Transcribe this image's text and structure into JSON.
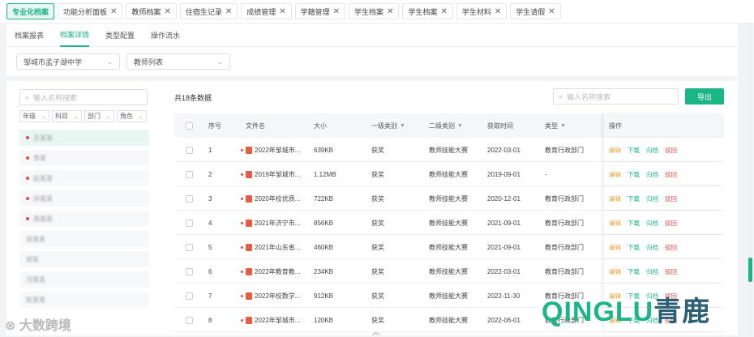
{
  "tabs": [
    {
      "label": "专业化档案",
      "active": true,
      "closable": false
    },
    {
      "label": "功能分析面板",
      "active": false,
      "closable": true
    },
    {
      "label": "教师档案",
      "active": false,
      "closable": true
    },
    {
      "label": "住宿生记录",
      "active": false,
      "closable": true
    },
    {
      "label": "成绩管理",
      "active": false,
      "closable": true
    },
    {
      "label": "学籍管理",
      "active": false,
      "closable": true
    },
    {
      "label": "学生档案",
      "active": false,
      "closable": true
    },
    {
      "label": "学生档案",
      "active": false,
      "closable": true
    },
    {
      "label": "学生材料",
      "active": false,
      "closable": true
    },
    {
      "label": "学生请假",
      "active": false,
      "closable": true
    }
  ],
  "subtabs": [
    {
      "label": "档案报表",
      "active": false
    },
    {
      "label": "档案详情",
      "active": true
    },
    {
      "label": "类型配置",
      "active": false
    },
    {
      "label": "操作流水"
    }
  ],
  "filters": {
    "school": "邹城市孟子湖中学",
    "list": "教师列表"
  },
  "left": {
    "search_placeholder": "输入名称搜索",
    "filter_labels": [
      "年级",
      "科目",
      "部门",
      "角色"
    ],
    "items": [
      {
        "label": "王某某",
        "dot": true,
        "selected": true
      },
      {
        "label": "李某",
        "dot": true,
        "selected": false
      },
      {
        "label": "赵某某",
        "dot": true,
        "selected": false
      },
      {
        "label": "孙某某",
        "dot": true,
        "selected": false
      },
      {
        "label": "周某某",
        "dot": true,
        "selected": false
      },
      {
        "label": "吴某某",
        "dot": false,
        "selected": false
      },
      {
        "label": "郑某",
        "dot": false,
        "selected": false
      },
      {
        "label": "冯某某",
        "dot": false,
        "selected": false
      },
      {
        "label": "陈某某",
        "dot": false,
        "selected": false
      }
    ]
  },
  "right": {
    "count_text": "共18条数据",
    "search_placeholder": "输入名称搜索",
    "export_label": "导出",
    "columns": {
      "index": "序号",
      "file": "文件名",
      "size": "大小",
      "cat1": "一级类别",
      "cat2": "二级类别",
      "time": "获取时间",
      "type": "类型",
      "ops": "操作"
    },
    "op_labels": {
      "edit": "编辑",
      "download": "下载",
      "archive": "归档",
      "reject": "驳回"
    },
    "rows": [
      {
        "index": "1",
        "file": "2022年邹城市...",
        "size": "639KB",
        "cat1": "获奖",
        "cat2": "教师技能大赛",
        "time": "2022-03-01",
        "type": "教育行政部门"
      },
      {
        "index": "2",
        "file": "2019年邹城市...",
        "size": "1.12MB",
        "cat1": "获奖",
        "cat2": "教师技能大赛",
        "time": "2019-09-01",
        "type": "-"
      },
      {
        "index": "3",
        "file": "2020年校优质...",
        "size": "722KB",
        "cat1": "获奖",
        "cat2": "教师技能大赛",
        "time": "2020-12-01",
        "type": "教育行政部门"
      },
      {
        "index": "4",
        "file": "2021年济宁市...",
        "size": "856KB",
        "cat1": "获奖",
        "cat2": "教师技能大赛",
        "time": "2021-09-01",
        "type": "教育行政部门"
      },
      {
        "index": "5",
        "file": "2021年山东省...",
        "size": "460KB",
        "cat1": "获奖",
        "cat2": "教师技能大赛",
        "time": "2021-09-01",
        "type": "教育行政部门"
      },
      {
        "index": "6",
        "file": "2022年教育教...",
        "size": "234KB",
        "cat1": "获奖",
        "cat2": "教师技能大赛",
        "time": "2022-03-01",
        "type": "教育行政部门"
      },
      {
        "index": "7",
        "file": "2022年校数学...",
        "size": "912KB",
        "cat1": "获奖",
        "cat2": "教师技能大赛",
        "time": "2022-11-30",
        "type": "教育行政部门"
      },
      {
        "index": "8",
        "file": "2022年邹城市...",
        "size": "120KB",
        "cat1": "获奖",
        "cat2": "教师技能大赛",
        "time": "2022-06-01",
        "type": "教育行政部门"
      }
    ]
  },
  "watermark": {
    "left": "大数跨境",
    "right_latin": "QINGLU",
    "right_cn": "青鹿"
  }
}
